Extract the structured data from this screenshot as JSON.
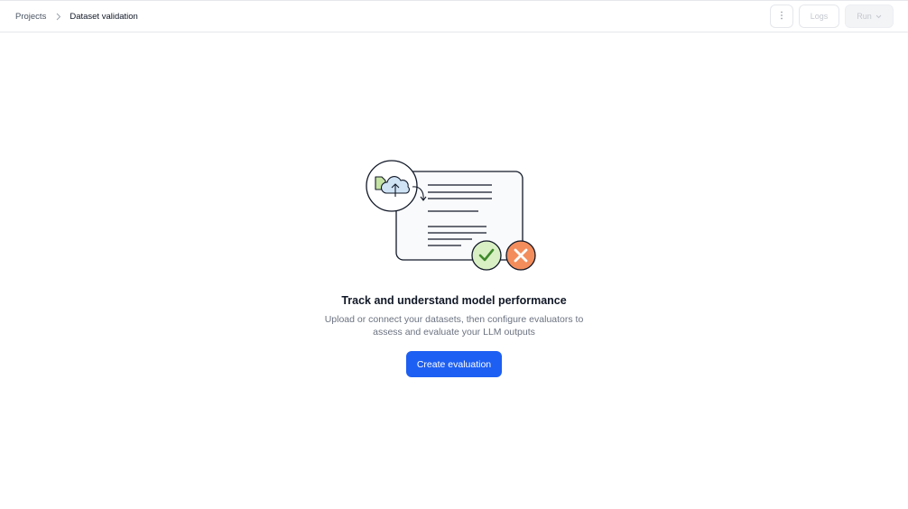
{
  "breadcrumb": {
    "parent": "Projects",
    "current": "Dataset validation"
  },
  "toolbar": {
    "more_icon": "more-vertical-icon",
    "logs_label": "Logs",
    "run_label": "Run",
    "run_icon": "chevron-down-icon"
  },
  "empty_state": {
    "title": "Track and understand model performance",
    "description": "Upload or connect your datasets, then configure evaluators to assess and evaluate your LLM outputs",
    "cta_label": "Create evaluation",
    "illustration_icons": [
      "file-icon",
      "cloud-upload-icon",
      "document-lines-icon",
      "check-circle-icon",
      "x-circle-icon"
    ]
  },
  "colors": {
    "primary": "#1d5ff2",
    "success_fill": "#d9f0c4",
    "success_stroke": "#3f8a2b",
    "error_fill": "#f38d5c",
    "cloud_fill": "#cfe3f5",
    "file_fill": "#c5e3a3"
  }
}
